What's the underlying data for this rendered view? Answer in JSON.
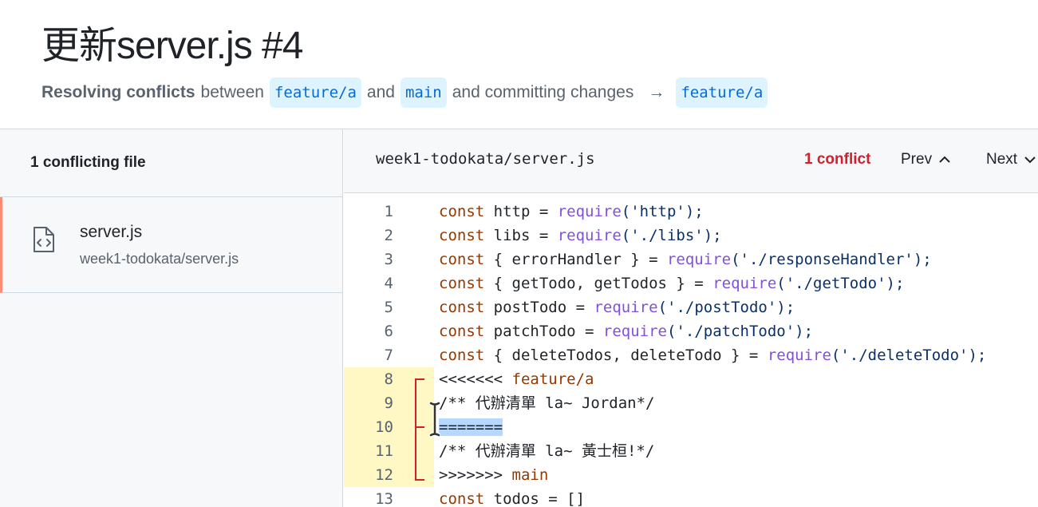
{
  "header": {
    "title": "更新server.js #4",
    "subtitle_strong": "Resolving conflicts",
    "subtitle_between": "between",
    "head_branch": "feature/a",
    "subtitle_and": "and",
    "base_branch": "main",
    "subtitle_committing": "and committing changes",
    "arrow": "→",
    "target_branch": "feature/a"
  },
  "sidebar": {
    "header": "1 conflicting file",
    "files": [
      {
        "name": "server.js",
        "path": "week1-todokata/server.js",
        "icon": "code-file-icon"
      }
    ]
  },
  "editor": {
    "path": "week1-todokata/server.js",
    "conflict_count": "1 conflict",
    "prev_label": "Prev",
    "next_label": "Next",
    "line_numbers": [
      "1",
      "2",
      "3",
      "4",
      "5",
      "6",
      "7",
      "8",
      "9",
      "10",
      "11",
      "12",
      "13"
    ],
    "lines": [
      {
        "kw": "const",
        "rest": " http = ",
        "fn": "require",
        "str": "('http');"
      },
      {
        "kw": "const",
        "rest": " libs = ",
        "fn": "require",
        "str": "('./libs');"
      },
      {
        "kw": "const",
        "rest": " { errorHandler } = ",
        "fn": "require",
        "str": "('./responseHandler');"
      },
      {
        "kw": "const",
        "rest": " { getTodo, getTodos } = ",
        "fn": "require",
        "str": "('./getTodo');"
      },
      {
        "kw": "const",
        "rest": " postTodo = ",
        "fn": "require",
        "str": "('./postTodo');"
      },
      {
        "kw": "const",
        "rest": " patchTodo = ",
        "fn": "require",
        "str": "('./patchTodo');"
      },
      {
        "kw": "const",
        "rest": " { deleteTodos, deleteTodo } = ",
        "fn": "require",
        "str": "('./deleteTodo');"
      }
    ],
    "conflict_start_marker": "<<<<<<< ",
    "conflict_start_branch": "feature/a",
    "ours_line": "/** 代辦清單 la~ Jordan*/",
    "separator_marker": "=======",
    "theirs_line": "/** 代辦清單 la~ 黃士桓!*/",
    "conflict_end_marker": ">>>>>>> ",
    "conflict_end_branch": "main",
    "line13_kw": "const",
    "line13_rest": " todos = []"
  },
  "colors": {
    "conflict_red": "#cf222e",
    "conflict_gutter": "#fff8c5",
    "branch_bg": "#ddf4ff",
    "branch_fg": "#0969da",
    "selection": "#b6d7ff"
  }
}
